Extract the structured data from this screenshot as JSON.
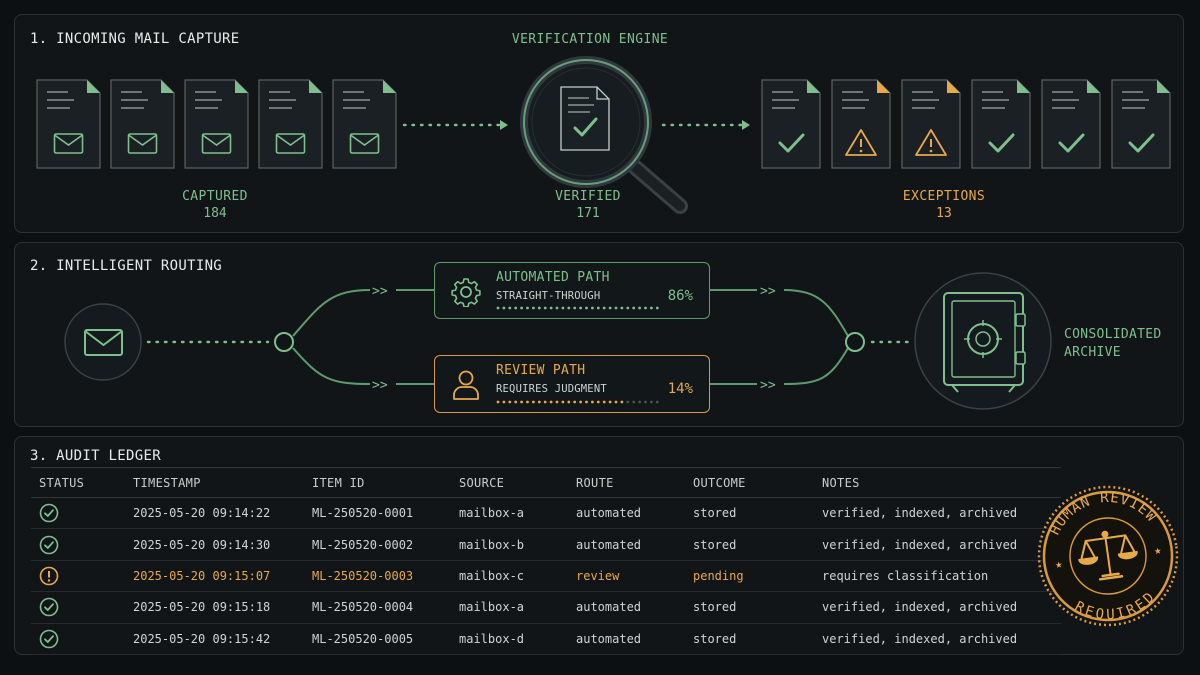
{
  "colors": {
    "green": "#7fbf8e",
    "amber": "#e8a94a",
    "line": "#5f9a6f"
  },
  "capture": {
    "title": "1. INCOMING MAIL CAPTURE",
    "engine_label": "VERIFICATION ENGINE",
    "captured": {
      "label": "CAPTURED",
      "value": "184"
    },
    "verified": {
      "label": "VERIFIED",
      "value": "171"
    },
    "exceptions": {
      "label": "EXCEPTIONS",
      "value": "13"
    },
    "input_docs": [
      "envelope-icon",
      "envelope-icon",
      "envelope-icon",
      "envelope-icon",
      "envelope-icon"
    ],
    "output_docs": [
      "check-icon",
      "warning-icon",
      "warning-icon",
      "check-icon",
      "check-icon",
      "check-icon"
    ]
  },
  "routing": {
    "title": "2. INTELLIGENT ROUTING",
    "automated": {
      "title": "AUTOMATED PATH",
      "subtitle": "STRAIGHT-THROUGH",
      "percent": "86%",
      "fill": 1.0
    },
    "review": {
      "title": "REVIEW PATH",
      "subtitle": "REQUIRES JUDGMENT",
      "percent": "14%",
      "fill": 0.8
    },
    "archive_line1": "CONSOLIDATED",
    "archive_line2": "ARCHIVE"
  },
  "ledger": {
    "title": "3. AUDIT LEDGER",
    "columns": [
      "STATUS",
      "TIMESTAMP",
      "ITEM ID",
      "SOURCE",
      "ROUTE",
      "OUTCOME",
      "NOTES"
    ],
    "rows": [
      {
        "status": "ok",
        "timestamp": "2025-05-20 09:14:22",
        "id": "ML-250520-0001",
        "source": "mailbox-a",
        "route": "automated",
        "outcome": "stored",
        "notes": "verified, indexed, archived"
      },
      {
        "status": "ok",
        "timestamp": "2025-05-20 09:14:30",
        "id": "ML-250520-0002",
        "source": "mailbox-b",
        "route": "automated",
        "outcome": "stored",
        "notes": "verified, indexed, archived"
      },
      {
        "status": "review",
        "timestamp": "2025-05-20 09:15:07",
        "id": "ML-250520-0003",
        "source": "mailbox-c",
        "route": "review",
        "outcome": "pending",
        "notes": "requires classification"
      },
      {
        "status": "ok",
        "timestamp": "2025-05-20 09:15:18",
        "id": "ML-250520-0004",
        "source": "mailbox-a",
        "route": "automated",
        "outcome": "stored",
        "notes": "verified, indexed, archived"
      },
      {
        "status": "ok",
        "timestamp": "2025-05-20 09:15:42",
        "id": "ML-250520-0005",
        "source": "mailbox-d",
        "route": "automated",
        "outcome": "stored",
        "notes": "verified, indexed, archived"
      }
    ]
  },
  "stamp": {
    "top_text": "HUMAN REVIEW",
    "bottom_text": "REQUIRED"
  }
}
